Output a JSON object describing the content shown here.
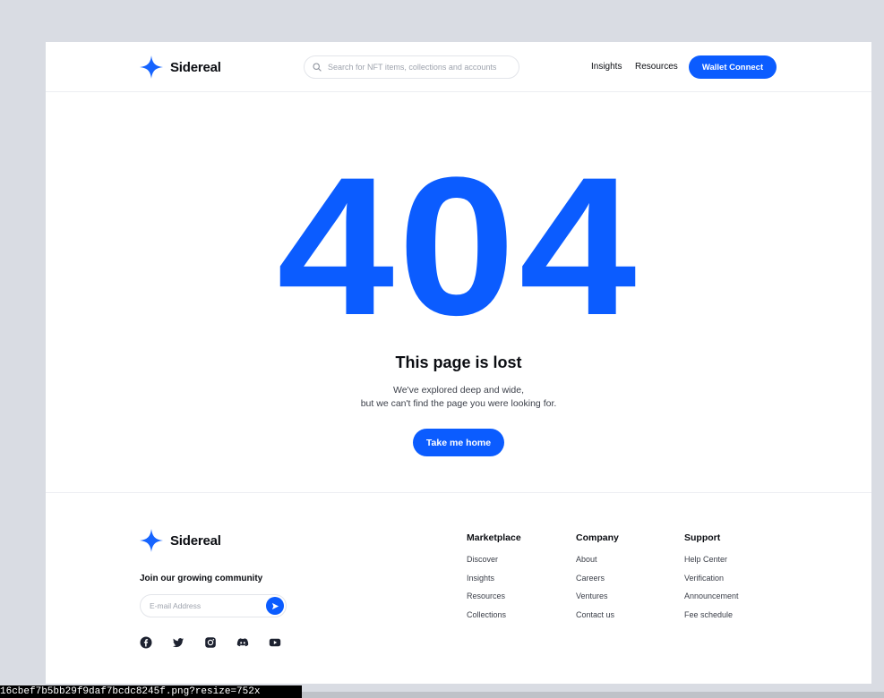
{
  "header": {
    "brand": "Sidereal",
    "search_placeholder": "Search for NFT items, collections and accounts",
    "nav": [
      "Insights",
      "Resources"
    ],
    "cta": "Wallet Connect"
  },
  "main": {
    "code": "404",
    "title": "This page is lost",
    "text_line1": "We've explored deep and wide,",
    "text_line2": "but we can't find the page you were looking for.",
    "button": "Take me home"
  },
  "footer": {
    "brand": "Sidereal",
    "community": "Join our growing community",
    "email_placeholder": "E-mail Address",
    "socials": [
      "facebook-icon",
      "twitter-icon",
      "instagram-icon",
      "discord-icon",
      "youtube-icon"
    ],
    "columns": [
      {
        "title": "Marketplace",
        "links": [
          "Discover",
          "Insights",
          "Resources",
          "Collections"
        ]
      },
      {
        "title": "Company",
        "links": [
          "About",
          "Careers",
          "Ventures",
          "Contact us"
        ]
      },
      {
        "title": "Support",
        "links": [
          "Help Center",
          "Verification",
          "Announcement",
          "Fee schedule"
        ]
      }
    ]
  },
  "window": {
    "filename": "16cbef7b5bb29f9daf7bcdc8245f.png?resize=752x"
  },
  "colors": {
    "accent": "#0b5cff",
    "text": "#0b0d12",
    "background": "#d9dce3"
  }
}
